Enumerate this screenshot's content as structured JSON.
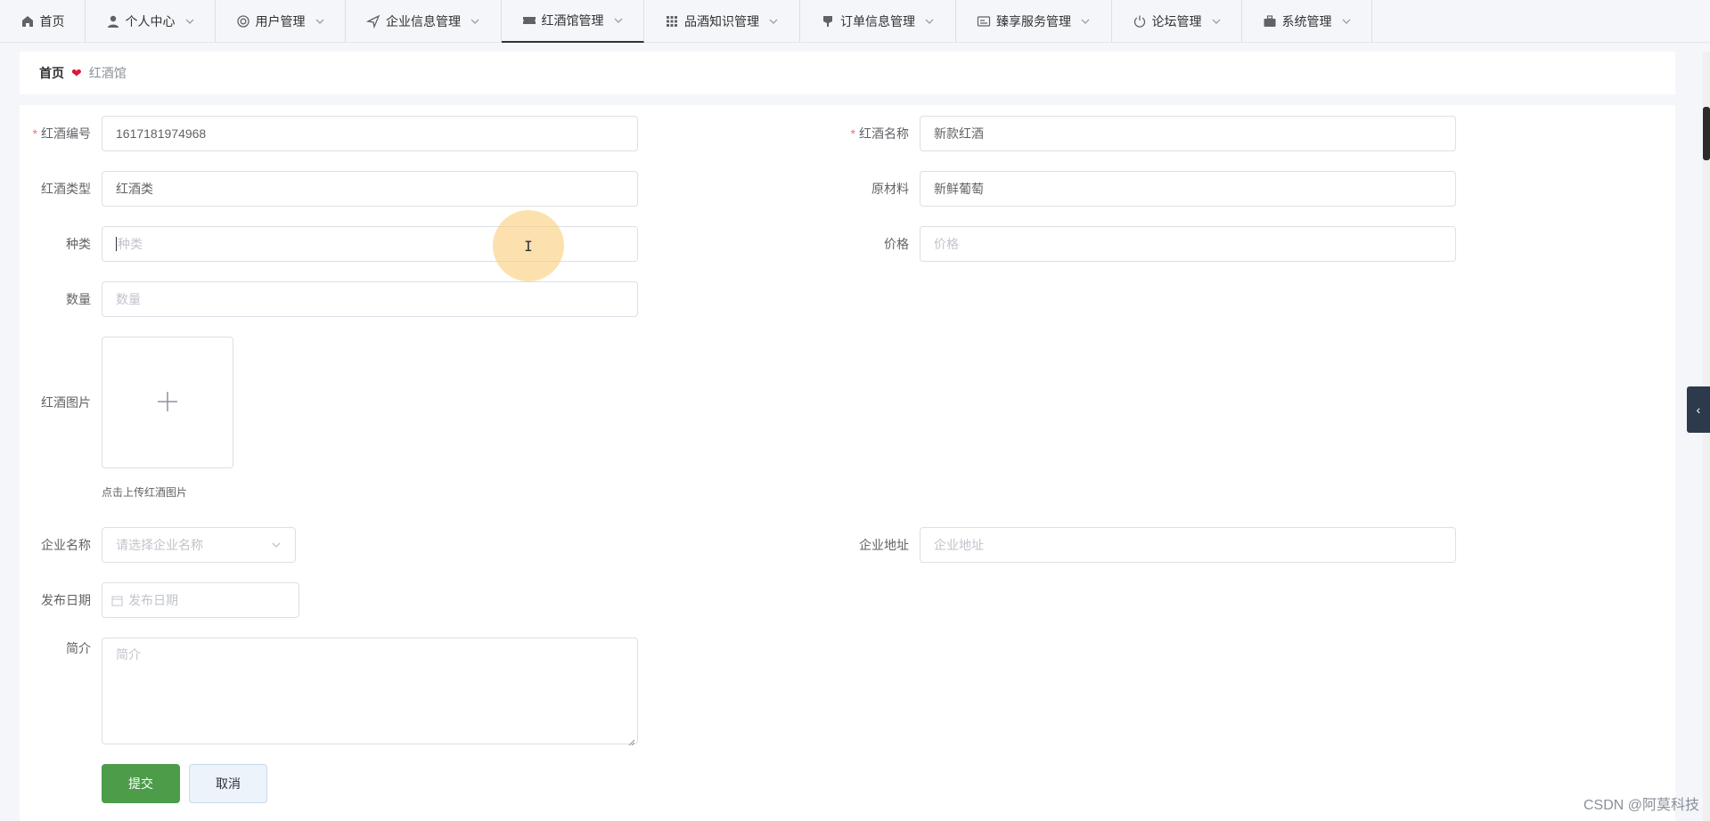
{
  "nav": {
    "items": [
      {
        "label": "首页",
        "icon": "home-icon"
      },
      {
        "label": "个人中心",
        "icon": "user-icon"
      },
      {
        "label": "用户管理",
        "icon": "users-icon"
      },
      {
        "label": "企业信息管理",
        "icon": "navigation-icon"
      },
      {
        "label": "红酒馆管理",
        "icon": "ticket-icon",
        "active": true
      },
      {
        "label": "品酒知识管理",
        "icon": "grid-icon"
      },
      {
        "label": "订单信息管理",
        "icon": "cup-icon"
      },
      {
        "label": "臻享服务管理",
        "icon": "card-icon"
      },
      {
        "label": "论坛管理",
        "icon": "power-icon"
      },
      {
        "label": "系统管理",
        "icon": "briefcase-icon"
      }
    ]
  },
  "breadcrumb": {
    "home": "首页",
    "current": "红酒馆"
  },
  "form": {
    "wine_no": {
      "label": "红酒编号",
      "value": "1617181974968"
    },
    "wine_name": {
      "label": "红酒名称",
      "value": "新款红酒"
    },
    "wine_type": {
      "label": "红酒类型",
      "value": "红酒类"
    },
    "material": {
      "label": "原材料",
      "value": "新鲜葡萄"
    },
    "category": {
      "label": "种类",
      "placeholder": "种类"
    },
    "price": {
      "label": "价格",
      "placeholder": "价格"
    },
    "quantity": {
      "label": "数量",
      "placeholder": "数量"
    },
    "image": {
      "label": "红酒图片",
      "hint": "点击上传红酒图片"
    },
    "company_name": {
      "label": "企业名称",
      "placeholder": "请选择企业名称"
    },
    "company_address": {
      "label": "企业地址",
      "placeholder": "企业地址"
    },
    "publish_date": {
      "label": "发布日期",
      "placeholder": "发布日期"
    },
    "intro": {
      "label": "简介",
      "placeholder": "简介"
    }
  },
  "buttons": {
    "submit": "提交",
    "cancel": "取消"
  },
  "watermark": "CSDN @阿莫科技",
  "colors": {
    "submit_bg": "#4c9c4a",
    "required": "#f56c6c",
    "heart": "#e0143c"
  }
}
